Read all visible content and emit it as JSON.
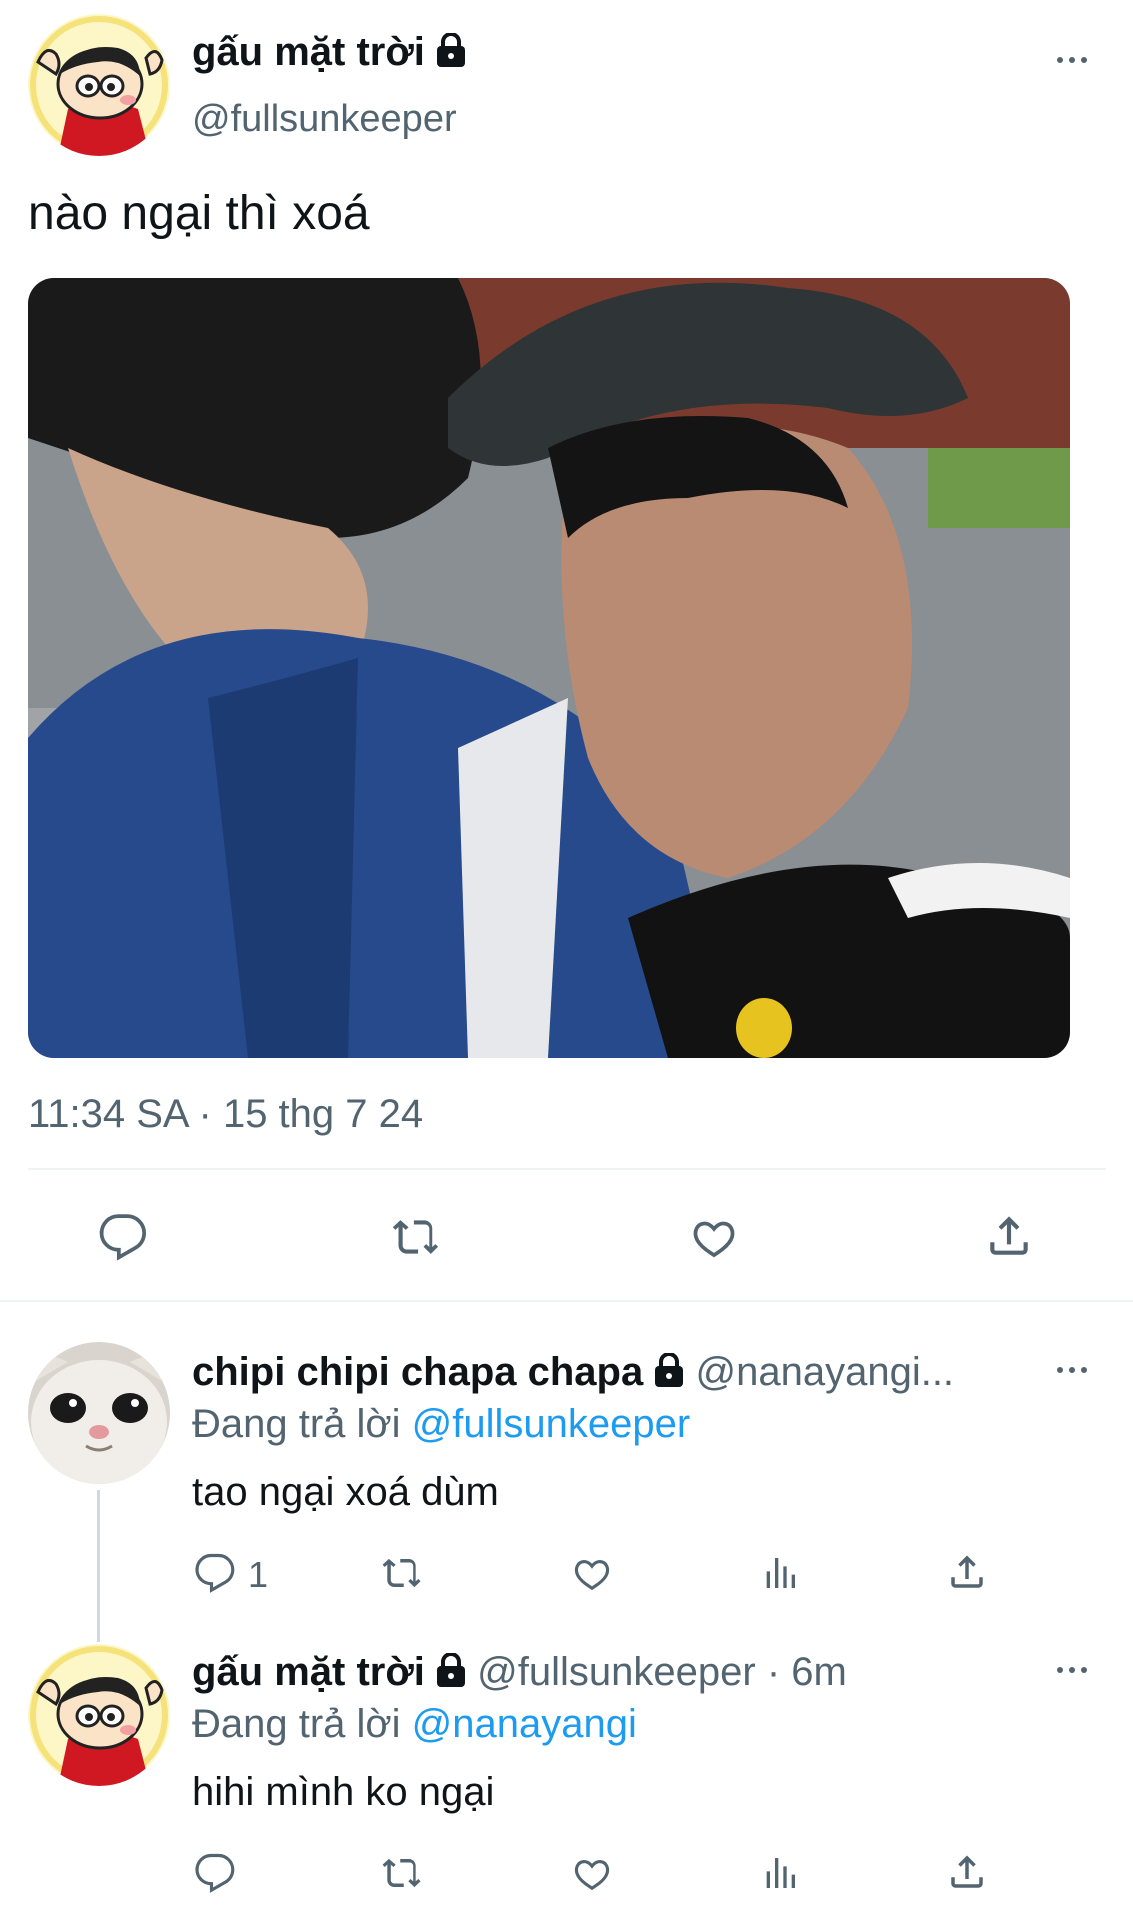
{
  "main_tweet": {
    "display_name": "gấu mặt trời",
    "handle": "@fullsunkeeper",
    "text": "nào ngại thì xoá",
    "timestamp": "11:34 SA · 15 thg 7 24",
    "image_alt": "photo of two young men outdoors"
  },
  "replies": [
    {
      "display_name": "chipi chipi chapa chapa",
      "handle": "@nanayangi...",
      "replying_prefix": "Đang trả lời",
      "replying_to": "@fullsunkeeper",
      "text": "tao ngại xoá dùm",
      "reply_count": "1"
    },
    {
      "display_name": "gấu mặt trời",
      "handle": "@fullsunkeeper · 6m",
      "replying_prefix": "Đang trả lời",
      "replying_to": "@nanayangi",
      "text": "hihi mình ko ngại"
    }
  ],
  "colors": {
    "accent": "#1d9bf0",
    "secondary_text": "#536471",
    "divider": "#eff3f4"
  },
  "icons": [
    "lock-icon",
    "more-icon",
    "reply-icon",
    "retweet-icon",
    "like-icon",
    "share-icon",
    "analytics-icon"
  ]
}
